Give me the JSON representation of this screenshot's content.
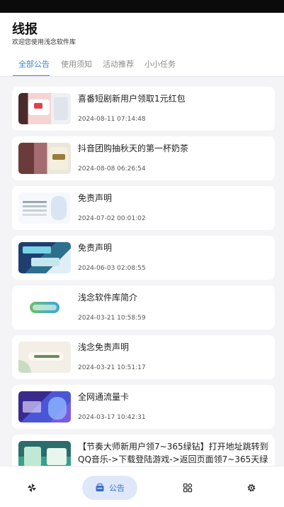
{
  "header": {
    "title": "线报",
    "subtitle": "欢迎您使用浅念软件库",
    "accent_color": "#3a86d6"
  },
  "tabs": [
    {
      "label": "全部公告",
      "active": true
    },
    {
      "label": "使用须知",
      "active": false
    },
    {
      "label": "活动推荐",
      "active": false
    },
    {
      "label": "小小任务",
      "active": false
    }
  ],
  "notices": [
    {
      "title": "喜番短剧新用户领取1元红包",
      "date": "2024-08-11 07:14:48"
    },
    {
      "title": "抖音团购抽秋天的第一杯奶茶",
      "date": "2024-08-08 06:26:54"
    },
    {
      "title": "免责声明",
      "date": "2024-07-02 00:01:02"
    },
    {
      "title": "免责声明",
      "date": "2024-06-03 02:08:55"
    },
    {
      "title": "浅念软件库简介",
      "date": "2024-03-21 10:58:59"
    },
    {
      "title": "浅念免责声明",
      "date": "2024-03-21 10:51:17"
    },
    {
      "title": "全网通流量卡",
      "date": "2024-03-17 10:42:31"
    },
    {
      "title": "【节奏大师新用户领7~365绿钻】打开地址跳转到QQ音乐->下载登陆游戏->返回页面领7~365天绿钻"
    }
  ],
  "bottom_nav": {
    "items": [
      {
        "icon": "pinwheel-icon"
      },
      {
        "icon": "announcement-icon",
        "label": "公告",
        "active": true
      },
      {
        "icon": "apps-grid-icon"
      },
      {
        "icon": "settings-gear-icon"
      }
    ]
  }
}
